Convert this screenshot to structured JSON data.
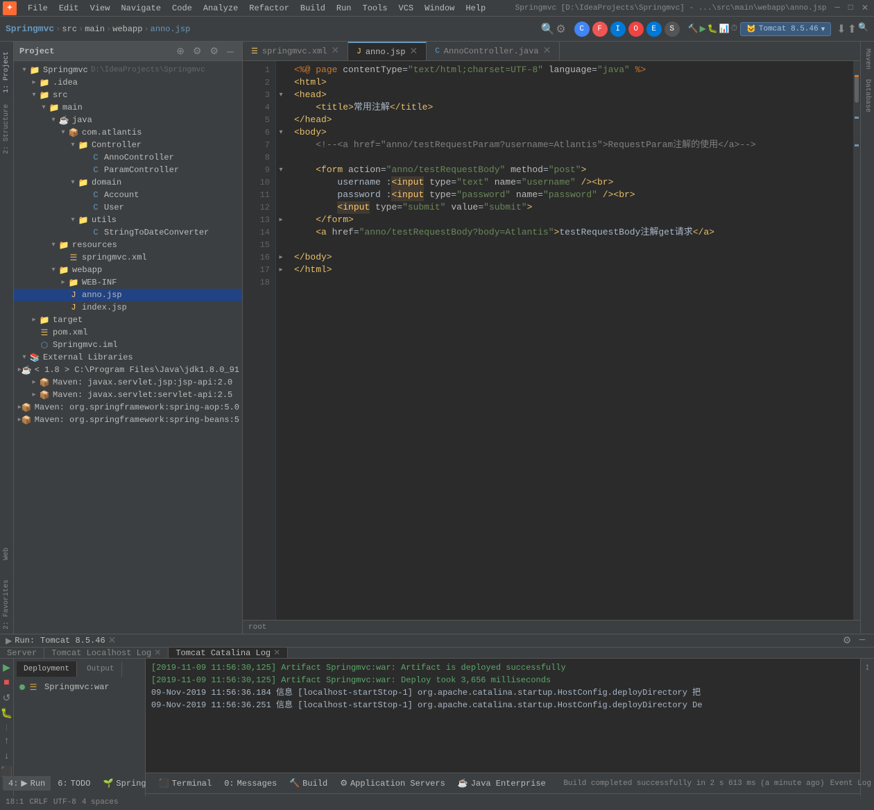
{
  "window": {
    "title": "Springmvc [D:\\IdeaProjects\\Springmvc] - ...\\src\\main\\webapp\\anno.jsp",
    "app": "IntelliJ IDEA"
  },
  "menu": {
    "items": [
      "File",
      "Edit",
      "View",
      "Navigate",
      "Code",
      "Analyze",
      "Refactor",
      "Build",
      "Run",
      "Tools",
      "VCS",
      "Window",
      "Help"
    ]
  },
  "toolbar": {
    "project_name": "Springmvc",
    "breadcrumb": [
      "src",
      "main",
      "webapp",
      "anno.jsp"
    ],
    "run_config": "Tomcat 8.5.46"
  },
  "project_panel": {
    "title": "Project",
    "root": {
      "name": "Springmvc",
      "path": "D:\\IdeaProjects\\Springmvc",
      "children": [
        {
          "name": ".idea",
          "type": "folder",
          "indent": 1
        },
        {
          "name": "src",
          "type": "folder",
          "indent": 1,
          "expanded": true,
          "children": [
            {
              "name": "main",
              "type": "folder",
              "indent": 2,
              "expanded": true,
              "children": [
                {
                  "name": "java",
                  "type": "folder",
                  "indent": 3,
                  "expanded": true,
                  "children": [
                    {
                      "name": "com.atlantis",
                      "type": "package",
                      "indent": 4,
                      "expanded": true,
                      "children": [
                        {
                          "name": "Controller",
                          "type": "folder",
                          "indent": 5,
                          "expanded": true,
                          "children": [
                            {
                              "name": "AnnoController",
                              "type": "class",
                              "indent": 6
                            },
                            {
                              "name": "ParamController",
                              "type": "class",
                              "indent": 6
                            }
                          ]
                        },
                        {
                          "name": "domain",
                          "type": "folder",
                          "indent": 5,
                          "expanded": true,
                          "children": [
                            {
                              "name": "Account",
                              "type": "class",
                              "indent": 6
                            },
                            {
                              "name": "User",
                              "type": "class",
                              "indent": 6
                            }
                          ]
                        },
                        {
                          "name": "utils",
                          "type": "folder",
                          "indent": 5,
                          "expanded": true,
                          "children": [
                            {
                              "name": "StringToDateConverter",
                              "type": "class",
                              "indent": 6
                            }
                          ]
                        }
                      ]
                    }
                  ]
                },
                {
                  "name": "resources",
                  "type": "folder",
                  "indent": 3,
                  "expanded": true,
                  "children": [
                    {
                      "name": "springmvc.xml",
                      "type": "xml",
                      "indent": 4
                    }
                  ]
                },
                {
                  "name": "webapp",
                  "type": "folder",
                  "indent": 3,
                  "expanded": true,
                  "children": [
                    {
                      "name": "WEB-INF",
                      "type": "folder",
                      "indent": 4
                    },
                    {
                      "name": "anno.jsp",
                      "type": "jsp",
                      "indent": 4
                    },
                    {
                      "name": "index.jsp",
                      "type": "jsp",
                      "indent": 4
                    }
                  ]
                }
              ]
            }
          ]
        },
        {
          "name": "target",
          "type": "folder",
          "indent": 1
        },
        {
          "name": "pom.xml",
          "type": "xml",
          "indent": 1
        },
        {
          "name": "Springmvc.iml",
          "type": "iml",
          "indent": 1
        }
      ]
    },
    "external_libraries": {
      "label": "External Libraries",
      "items": [
        "< 1.8 > C:\\Program Files\\Java\\jdk1.8.0_91",
        "Maven: javax.servlet.jsp:jsp-api:2.0",
        "Maven: javax.servlet:servlet-api:2.5",
        "Maven: org.springframework:spring-aop:5.0",
        "Maven: org.springframework:spring-beans:5"
      ]
    }
  },
  "editor": {
    "tabs": [
      {
        "name": "springmvc.xml",
        "type": "xml",
        "active": false
      },
      {
        "name": "anno.jsp",
        "type": "jsp",
        "active": true
      },
      {
        "name": "AnnoController.java",
        "type": "java",
        "active": false
      }
    ],
    "lines": [
      {
        "num": 1,
        "fold": false,
        "content": "<%@ page contentType=\"text/html;charset=UTF-8\" language=\"java\" %>"
      },
      {
        "num": 2,
        "fold": false,
        "content": "<html>"
      },
      {
        "num": 3,
        "fold": false,
        "content": "<head>"
      },
      {
        "num": 4,
        "fold": false,
        "content": "    <title>常用注解</title>"
      },
      {
        "num": 5,
        "fold": false,
        "content": "</head>"
      },
      {
        "num": 6,
        "fold": false,
        "content": "<body>"
      },
      {
        "num": 7,
        "fold": false,
        "content": "    <!--<a href=\"anno/testRequestParam?username=Atlantis\">RequestParam注解的使用</a>-->"
      },
      {
        "num": 8,
        "fold": false,
        "content": ""
      },
      {
        "num": 9,
        "fold": true,
        "content": "    <form action=\"anno/testRequestBody\" method=\"post\">"
      },
      {
        "num": 10,
        "fold": false,
        "content": "        username :<input type=\"text\" name=\"username\" /><br>"
      },
      {
        "num": 11,
        "fold": false,
        "content": "        password :<input type=\"password\" name=\"password\" /><br>"
      },
      {
        "num": 12,
        "fold": false,
        "content": "        <input type=\"submit\" value=\"submit\">"
      },
      {
        "num": 13,
        "fold": false,
        "content": "    </form>"
      },
      {
        "num": 14,
        "fold": false,
        "content": "    <a href=\"anno/testRequestBody?body=Atlantis\">testRequestBody注解get请求</a>"
      },
      {
        "num": 15,
        "fold": false,
        "content": ""
      },
      {
        "num": 16,
        "fold": false,
        "content": "</body>"
      },
      {
        "num": 17,
        "fold": false,
        "content": "</html>"
      },
      {
        "num": 18,
        "fold": false,
        "content": ""
      }
    ],
    "status": {
      "line": 18,
      "col": 1,
      "encoding": "UTF-8",
      "line_sep": "CRLF",
      "indent": "4 spaces"
    }
  },
  "run_panel": {
    "title": "Run",
    "tomcat": "Tomcat 8.5.46",
    "tabs": [
      {
        "name": "Server",
        "active": false
      },
      {
        "name": "Tomcat Localhost Log",
        "active": false
      },
      {
        "name": "Tomcat Catalina Log",
        "active": true
      }
    ],
    "sub_tabs": [
      {
        "name": "Deployment",
        "active": true
      },
      {
        "name": "Output",
        "active": false
      }
    ],
    "deployment": {
      "item": "Springmvc:war"
    },
    "log_lines": [
      {
        "text": "[2019-11-09 11:56:30,125] Artifact Springmvc:war: Artifact is deployed successfully",
        "type": "success"
      },
      {
        "text": "[2019-11-09 11:56:30,125] Artifact Springmvc:war: Deploy took 3,656 milliseconds",
        "type": "success"
      },
      {
        "text": "09-Nov-2019 11:56:36.184 信息 [localhost-startStop-1] org.apache.catalina.startup.HostConfig.deployDirectory 把",
        "type": "info"
      },
      {
        "text": "09-Nov-2019 11:56:36.251 信息 [localhost-startStop-1] org.apache.catalina.startup.HostConfig.deployDirectory De",
        "type": "info"
      }
    ]
  },
  "taskbar": {
    "items": [
      {
        "num": "4",
        "label": "Run",
        "icon": "▶"
      },
      {
        "num": "6",
        "label": "TODO",
        "icon": "✓"
      },
      {
        "label": "Spring",
        "icon": "🌱"
      },
      {
        "label": "Terminal",
        "icon": "⬛"
      },
      {
        "num": "0",
        "label": "Messages",
        "icon": "💬"
      },
      {
        "label": "Build",
        "icon": "🔨"
      },
      {
        "label": "Application Servers",
        "icon": "⚙"
      },
      {
        "label": "Java Enterprise",
        "icon": "☕"
      }
    ],
    "status": "Build completed successfully in 2 s 613 ms (a minute ago)",
    "right": "Event Log"
  },
  "maven_panel": {
    "label": "Maven"
  },
  "database_panel": {
    "label": "Database"
  },
  "structure_panel": {
    "label": "Structure"
  },
  "web_panel": {
    "label": "Web"
  },
  "favorites_panel": {
    "label": "Favorites"
  }
}
